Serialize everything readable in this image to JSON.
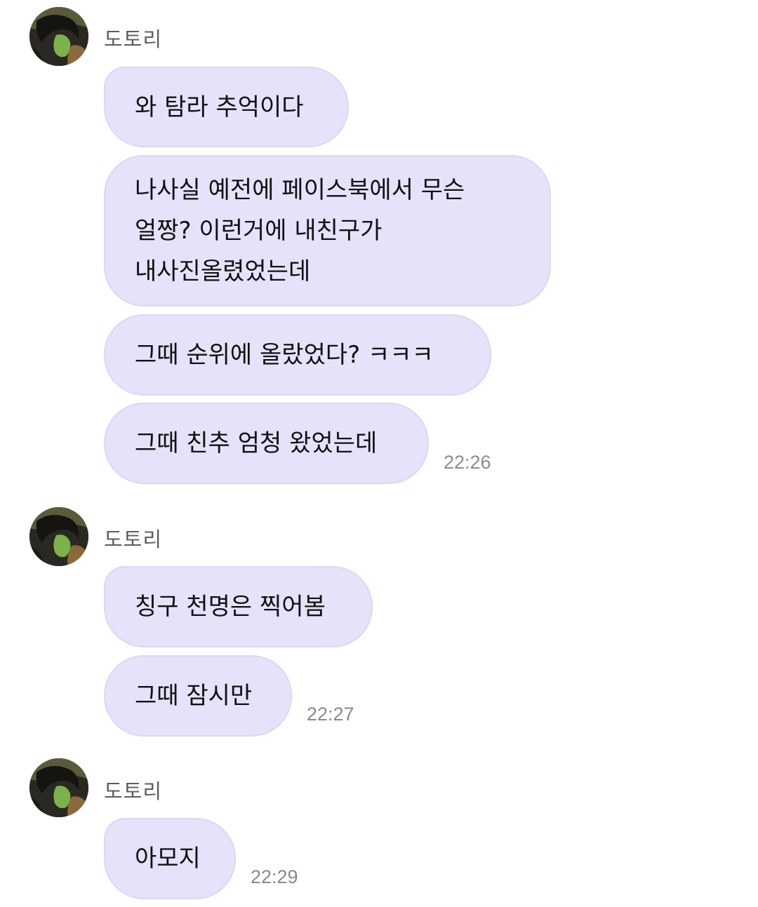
{
  "groups": [
    {
      "sender": "도토리",
      "messages": [
        {
          "text": "와 탐라 추억이다"
        },
        {
          "lines": [
            "나사실 예전에 페이스북에서 무슨",
            "얼짱? 이런거에 내친구가",
            "내사진올렸었는데"
          ]
        },
        {
          "text": "그때 순위에 올랐었다? ㅋㅋㅋ"
        },
        {
          "text": "그때 친추 엄청 왔었는데"
        }
      ],
      "time": "22:26"
    },
    {
      "sender": "도토리",
      "messages": [
        {
          "text": "칭구 천명은 찍어봄"
        },
        {
          "text": "그때 잠시만"
        }
      ],
      "time": "22:27"
    },
    {
      "sender": "도토리",
      "messages": [
        {
          "text": "아모지"
        }
      ],
      "time": "22:29"
    }
  ],
  "colors": {
    "bubble_bg": "#e5e2fa",
    "bubble_border": "#dcd8f4",
    "sender_text": "#5c5c5c",
    "time_text": "#8a8a8a"
  },
  "icons": {
    "avatar": "profile-photo"
  }
}
